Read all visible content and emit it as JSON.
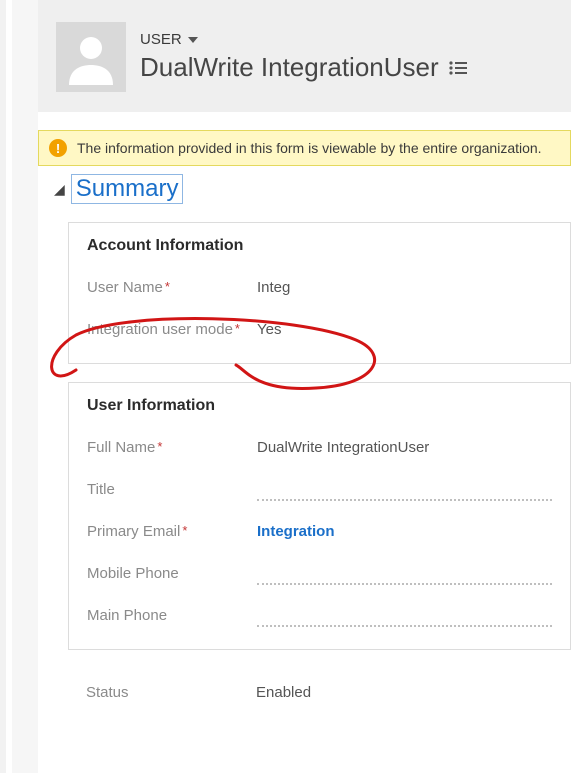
{
  "header": {
    "crumb_label": "USER",
    "title": "DualWrite IntegrationUser"
  },
  "notification": {
    "icon_glyph": "!",
    "text": "The information provided in this form is viewable by the entire organization."
  },
  "summary": {
    "heading": "Summary"
  },
  "account_info": {
    "title": "Account Information",
    "fields": {
      "user_name": {
        "label": "User Name",
        "value": "Integ",
        "required": true
      },
      "integration_user_mode": {
        "label": "Integration user mode",
        "value": "Yes",
        "required": true
      }
    }
  },
  "user_info": {
    "title": "User Information",
    "fields": {
      "full_name": {
        "label": "Full Name",
        "value": "DualWrite IntegrationUser",
        "required": true
      },
      "title": {
        "label": "Title",
        "value": ""
      },
      "primary_email": {
        "label": "Primary Email",
        "value": "Integration",
        "required": true
      },
      "mobile_phone": {
        "label": "Mobile Phone",
        "value": ""
      },
      "main_phone": {
        "label": "Main Phone",
        "value": ""
      },
      "status": {
        "label": "Status",
        "value": "Enabled"
      }
    }
  }
}
